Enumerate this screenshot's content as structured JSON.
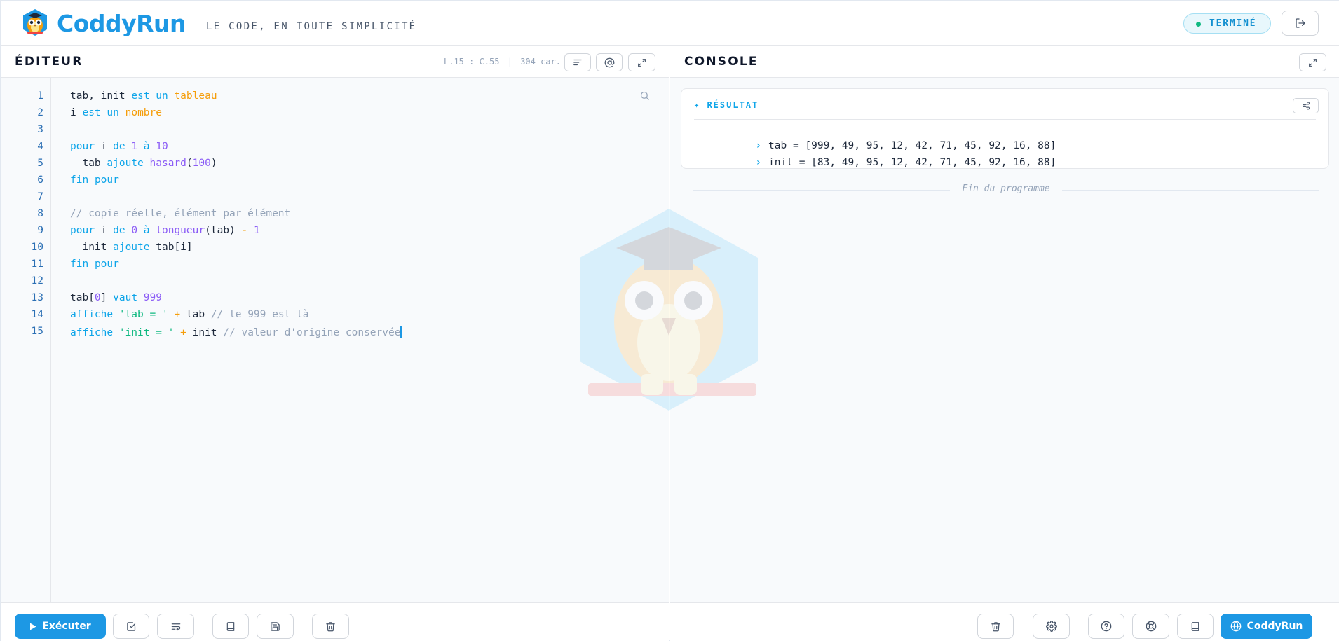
{
  "header": {
    "brand": "CoddyRun",
    "tagline": "LE CODE, EN TOUTE SIMPLICITÉ",
    "status": "TERMINÉ",
    "status_color": "#10b981",
    "logout_icon": "logout-icon"
  },
  "editor": {
    "title": "ÉDITEUR",
    "cursor_info": "L.15 : C.55",
    "separator": "|",
    "char_count": "304 car.",
    "line_numbers": [
      "1",
      "2",
      "3",
      "4",
      "5",
      "6",
      "7",
      "8",
      "9",
      "10",
      "11",
      "12",
      "13",
      "14",
      "15"
    ],
    "code_lines": [
      "tab, init est un tableau",
      "i est un nombre",
      "",
      "pour i de 1 à 10",
      "  tab ajoute hasard(100)",
      "fin pour",
      "",
      "// copie réelle, élément par élément",
      "pour i de 0 à longueur(tab) - 1",
      "  init ajoute tab[i]",
      "fin pour",
      "",
      "tab[0] vaut 999",
      "affiche 'tab = ' + tab // le 999 est là",
      "affiche 'init = ' + init // valeur d'origine conservée"
    ]
  },
  "console": {
    "title": "CONSOLE",
    "result_title": "✦ RÉSULTAT",
    "output": [
      "tab = [999, 49, 95, 12, 42, 71, 45, 92, 16, 88]",
      "init = [83, 49, 95, 12, 42, 71, 45, 92, 16, 88]"
    ],
    "end_text": "Fin du programme"
  },
  "footer": {
    "run_label": "Exécuter",
    "site_label": "CoddyRun"
  },
  "colors": {
    "accent": "#1d98e4",
    "keyword": "#0ea5e9",
    "type": "#f59e0b",
    "function": "#8b5cf6",
    "comment": "#94a3b8",
    "string": "#10b981"
  }
}
